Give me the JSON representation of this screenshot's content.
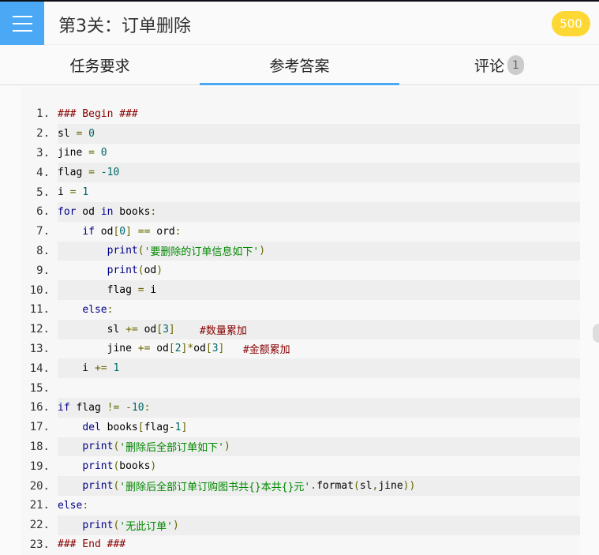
{
  "header": {
    "title": "第3关：订单删除",
    "coins": "500",
    "menu_icon": "hamburger-icon"
  },
  "tabs": [
    {
      "label": "任务要求"
    },
    {
      "label": "参考答案",
      "active": true
    },
    {
      "label": "评论",
      "badge": "1"
    }
  ],
  "code": {
    "lines": [
      {
        "n": "1.",
        "t": [
          [
            "com",
            "### Begin ###"
          ]
        ]
      },
      {
        "n": "2.",
        "t": [
          [
            "pln",
            "sl "
          ],
          [
            "pun",
            "="
          ],
          [
            "pln",
            " "
          ],
          [
            "lit",
            "0"
          ]
        ]
      },
      {
        "n": "3.",
        "t": [
          [
            "pln",
            "jine "
          ],
          [
            "pun",
            "="
          ],
          [
            "pln",
            " "
          ],
          [
            "lit",
            "0"
          ]
        ]
      },
      {
        "n": "4.",
        "t": [
          [
            "pln",
            "flag "
          ],
          [
            "pun",
            "="
          ],
          [
            "pln",
            " "
          ],
          [
            "lit",
            "-10"
          ]
        ]
      },
      {
        "n": "5.",
        "t": [
          [
            "pln",
            "i "
          ],
          [
            "pun",
            "="
          ],
          [
            "pln",
            " "
          ],
          [
            "lit",
            "1"
          ]
        ]
      },
      {
        "n": "6.",
        "t": [
          [
            "kwd",
            "for"
          ],
          [
            "pln",
            " od "
          ],
          [
            "kwd",
            "in"
          ],
          [
            "pln",
            " books"
          ],
          [
            "pun",
            ":"
          ]
        ]
      },
      {
        "n": "7.",
        "t": [
          [
            "pln",
            "    "
          ],
          [
            "kwd",
            "if"
          ],
          [
            "pln",
            " od"
          ],
          [
            "pun",
            "["
          ],
          [
            "lit",
            "0"
          ],
          [
            "pun",
            "]"
          ],
          [
            "pln",
            " "
          ],
          [
            "pun",
            "=="
          ],
          [
            "pln",
            " ord"
          ],
          [
            "pun",
            ":"
          ]
        ]
      },
      {
        "n": "8.",
        "t": [
          [
            "pln",
            "        "
          ],
          [
            "kwd",
            "print"
          ],
          [
            "pun",
            "("
          ],
          [
            "str",
            "'要删除的订单信息如下'"
          ],
          [
            "pun",
            ")"
          ]
        ]
      },
      {
        "n": "9.",
        "t": [
          [
            "pln",
            "        "
          ],
          [
            "kwd",
            "print"
          ],
          [
            "pun",
            "("
          ],
          [
            "pln",
            "od"
          ],
          [
            "pun",
            ")"
          ]
        ]
      },
      {
        "n": "10.",
        "t": [
          [
            "pln",
            "        flag "
          ],
          [
            "pun",
            "="
          ],
          [
            "pln",
            " i"
          ]
        ]
      },
      {
        "n": "11.",
        "t": [
          [
            "pln",
            "    "
          ],
          [
            "kwd",
            "else"
          ],
          [
            "pun",
            ":"
          ]
        ]
      },
      {
        "n": "12.",
        "t": [
          [
            "pln",
            "        sl "
          ],
          [
            "pun",
            "+="
          ],
          [
            "pln",
            " od"
          ],
          [
            "pun",
            "["
          ],
          [
            "lit",
            "3"
          ],
          [
            "pun",
            "]"
          ],
          [
            "pln",
            "    "
          ],
          [
            "com",
            "#数量累加"
          ]
        ]
      },
      {
        "n": "13.",
        "t": [
          [
            "pln",
            "        jine "
          ],
          [
            "pun",
            "+="
          ],
          [
            "pln",
            " od"
          ],
          [
            "pun",
            "["
          ],
          [
            "lit",
            "2"
          ],
          [
            "pun",
            "]*"
          ],
          [
            "pln",
            "od"
          ],
          [
            "pun",
            "["
          ],
          [
            "lit",
            "3"
          ],
          [
            "pun",
            "]"
          ],
          [
            "pln",
            "   "
          ],
          [
            "com",
            "#金额累加"
          ]
        ]
      },
      {
        "n": "14.",
        "t": [
          [
            "pln",
            "    i "
          ],
          [
            "pun",
            "+="
          ],
          [
            "pln",
            " "
          ],
          [
            "lit",
            "1"
          ]
        ]
      },
      {
        "n": "15.",
        "t": []
      },
      {
        "n": "16.",
        "t": [
          [
            "kwd",
            "if"
          ],
          [
            "pln",
            " flag "
          ],
          [
            "pun",
            "!="
          ],
          [
            "pln",
            " "
          ],
          [
            "pun",
            "-"
          ],
          [
            "lit",
            "10"
          ],
          [
            "pun",
            ":"
          ]
        ]
      },
      {
        "n": "17.",
        "t": [
          [
            "pln",
            "    "
          ],
          [
            "kwd",
            "del"
          ],
          [
            "pln",
            " books"
          ],
          [
            "pun",
            "["
          ],
          [
            "pln",
            "flag"
          ],
          [
            "pun",
            "-"
          ],
          [
            "lit",
            "1"
          ],
          [
            "pun",
            "]"
          ]
        ]
      },
      {
        "n": "18.",
        "t": [
          [
            "pln",
            "    "
          ],
          [
            "kwd",
            "print"
          ],
          [
            "pun",
            "("
          ],
          [
            "str",
            "'删除后全部订单如下'"
          ],
          [
            "pun",
            ")"
          ]
        ]
      },
      {
        "n": "19.",
        "t": [
          [
            "pln",
            "    "
          ],
          [
            "kwd",
            "print"
          ],
          [
            "pun",
            "("
          ],
          [
            "pln",
            "books"
          ],
          [
            "pun",
            ")"
          ]
        ]
      },
      {
        "n": "20.",
        "t": [
          [
            "pln",
            "    "
          ],
          [
            "kwd",
            "print"
          ],
          [
            "pun",
            "("
          ],
          [
            "str",
            "'删除后全部订单订购图书共{}本共{}元'"
          ],
          [
            "pun",
            "."
          ],
          [
            "pln",
            "format"
          ],
          [
            "pun",
            "("
          ],
          [
            "pln",
            "sl"
          ],
          [
            "pun",
            ","
          ],
          [
            "pln",
            "jine"
          ],
          [
            "pun",
            "))"
          ]
        ]
      },
      {
        "n": "21.",
        "t": [
          [
            "kwd",
            "else"
          ],
          [
            "pun",
            ":"
          ]
        ]
      },
      {
        "n": "22.",
        "t": [
          [
            "pln",
            "    "
          ],
          [
            "kwd",
            "print"
          ],
          [
            "pun",
            "("
          ],
          [
            "str",
            "'无此订单'"
          ],
          [
            "pun",
            ")"
          ]
        ]
      },
      {
        "n": "23.",
        "t": [
          [
            "com",
            "### End ###"
          ]
        ]
      }
    ]
  }
}
